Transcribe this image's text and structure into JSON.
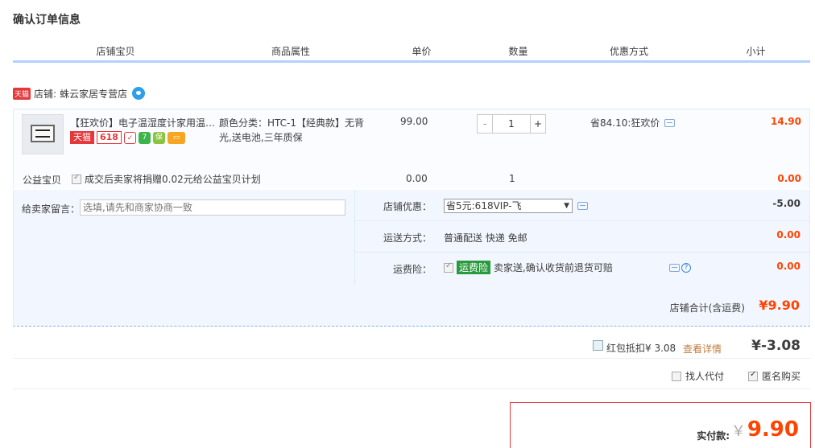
{
  "page": {
    "title": "确认订单信息"
  },
  "columns": [
    "店铺宝贝",
    "商品属性",
    "单价",
    "数量",
    "优惠方式",
    "小计"
  ],
  "shop": {
    "tag": "天猫",
    "name_prefix": "店铺:",
    "name": "蛛云家居专营店"
  },
  "item": {
    "title": "【狂欢价】电子温湿度计家用温…",
    "badge_tmall": "天猫",
    "badge_618": "618",
    "attribute": "颜色分类：HTC-1【经典款】无背光,送电池,三年质保",
    "price": "99.00",
    "quantity": "1",
    "minus": "-",
    "plus": "+",
    "promo": "省84.10:狂欢价",
    "subtotal": "14.90"
  },
  "charity": {
    "label": "公益宝贝",
    "text": "成交后卖家将捐赠0.02元给公益宝贝计划",
    "price": "0.00",
    "quantity": "1",
    "subtotal": "0.00"
  },
  "message": {
    "label": "给卖家留言：",
    "placeholder": "选填,请先和商家协商一致"
  },
  "shop_discount": {
    "label": "店铺优惠：",
    "selected": "省5元:618VIP-飞",
    "amount": "-5.00"
  },
  "shipping": {
    "label": "运送方式：",
    "value": "普通配送 快递 免邮",
    "amount": "0.00"
  },
  "insurance": {
    "label": "运费险：",
    "tag": "运费险",
    "text": "卖家送,确认收货前退货可赔",
    "amount": "0.00"
  },
  "shop_total": {
    "label": "店铺合计(含运费)",
    "amount": "¥9.90"
  },
  "red_packet": {
    "text": "红包抵扣¥ 3.08",
    "detail": "查看详情",
    "amount": "¥-3.08"
  },
  "options": {
    "proxy_pay": "找人代付",
    "anonymous": "匿名购买"
  },
  "payment": {
    "label": "实付款:",
    "yen": "￥",
    "amount": "9.90"
  }
}
